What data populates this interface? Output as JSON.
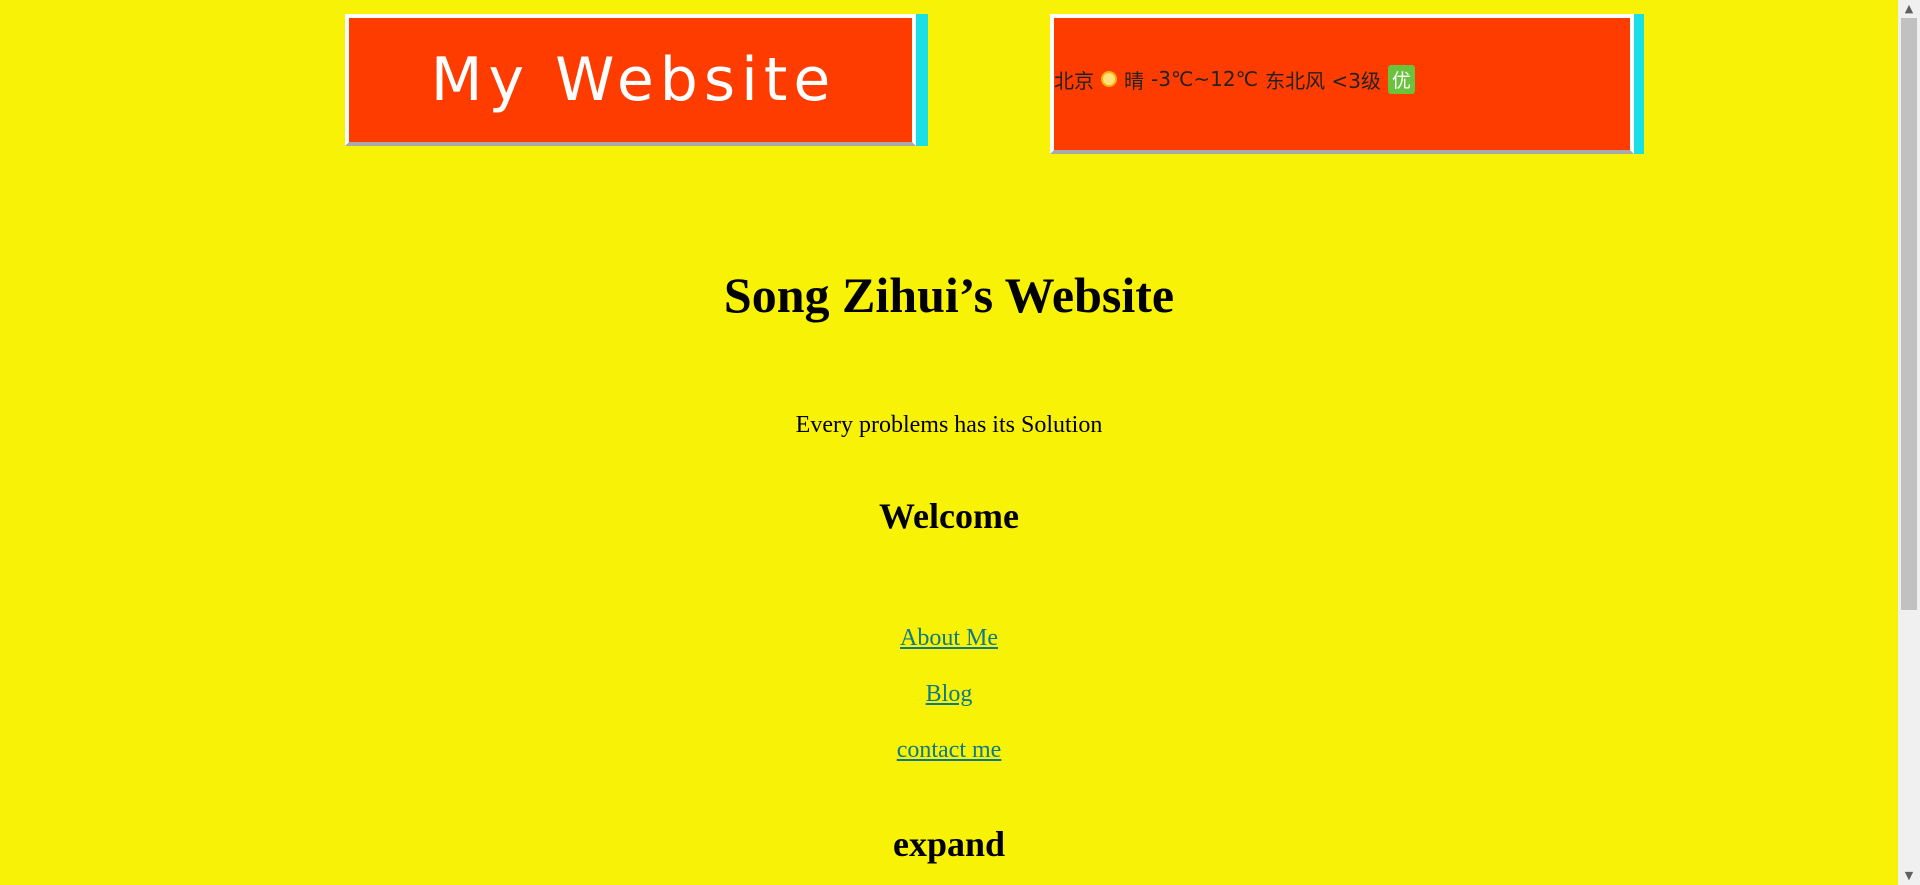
{
  "header": {
    "logo_text": "My Website",
    "weather": {
      "city": "北京",
      "condition_icon": "sun-icon",
      "condition": "晴",
      "temperature": "-3℃~12℃",
      "wind": "东北风 <3级",
      "air_quality": "优"
    }
  },
  "main": {
    "title": "Song Zihui’s Website",
    "tagline": "Every problems has its Solution",
    "welcome_heading": "Welcome",
    "links": [
      "About Me",
      "Blog",
      "contact me"
    ],
    "expand_heading": "expand"
  },
  "colors": {
    "page_background": "#f8f206",
    "box_background": "#ff3c00",
    "box_accent": "#19e0e6",
    "link": "#0e7a8a",
    "badge": "#69c33c"
  },
  "scrollbar": {
    "up_icon": "▲",
    "down_icon": "▼"
  }
}
